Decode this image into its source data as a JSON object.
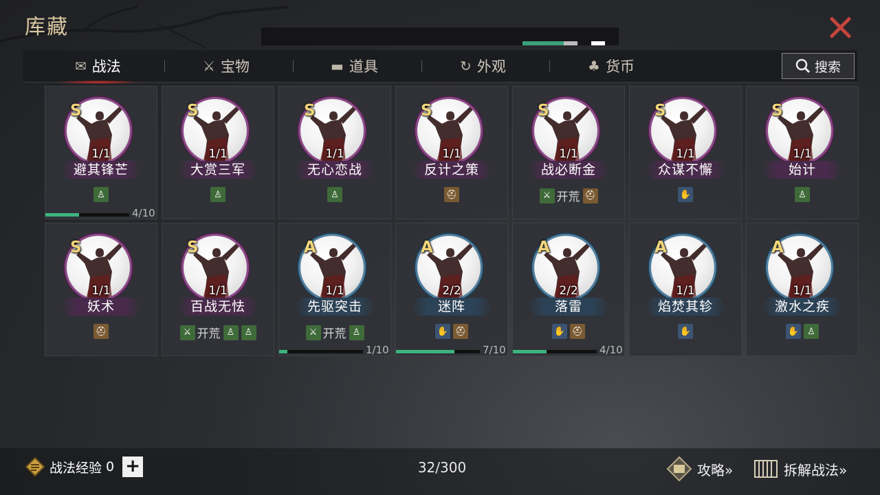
{
  "header": {
    "title": "库藏"
  },
  "tabs": [
    {
      "label": "战法",
      "icon": "scroll-bundle-icon",
      "active": true
    },
    {
      "label": "宝物",
      "icon": "treasure-weapon-icon",
      "active": false
    },
    {
      "label": "道具",
      "icon": "chest-icon",
      "active": false
    },
    {
      "label": "外观",
      "icon": "appearance-swirl-icon",
      "active": false
    },
    {
      "label": "货币",
      "icon": "money-bag-icon",
      "active": false
    }
  ],
  "search": {
    "label": "搜索"
  },
  "cards": [
    {
      "grade": "S",
      "count": "1/1",
      "name": "避其锋芒",
      "tags": [
        "green"
      ],
      "progress": {
        "value": 4,
        "max": 10,
        "text": "4/10"
      }
    },
    {
      "grade": "S",
      "count": "1/1",
      "name": "大赏三军",
      "tags": [
        "green"
      ]
    },
    {
      "grade": "S",
      "count": "1/1",
      "name": "无心恋战",
      "tags": [
        "green"
      ]
    },
    {
      "grade": "S",
      "count": "1/1",
      "name": "反计之策",
      "tags": [
        "brown"
      ]
    },
    {
      "grade": "S",
      "count": "1/1",
      "name": "战必断金",
      "kaihuang": "开荒",
      "tags": [
        "brown"
      ]
    },
    {
      "grade": "S",
      "count": "1/1",
      "name": "众谋不懈",
      "tags": [
        "blue"
      ]
    },
    {
      "grade": "S",
      "count": "1/1",
      "name": "始计",
      "tags": [
        "green"
      ]
    },
    {
      "grade": "S",
      "count": "1/1",
      "name": "妖术",
      "tags": [
        "brown"
      ]
    },
    {
      "grade": "S",
      "count": "1/1",
      "name": "百战无怯",
      "kaihuang": "开荒",
      "tags": [
        "green",
        "green"
      ]
    },
    {
      "grade": "A",
      "count": "1/1",
      "name": "先驱突击",
      "kaihuang": "开荒",
      "tags": [
        "green"
      ],
      "progress": {
        "value": 1,
        "max": 10,
        "text": "1/10"
      }
    },
    {
      "grade": "A",
      "count": "2/2",
      "name": "迷阵",
      "tags": [
        "blue",
        "brown"
      ],
      "progress": {
        "value": 7,
        "max": 10,
        "text": "7/10"
      }
    },
    {
      "grade": "A",
      "count": "2/2",
      "name": "落雷",
      "tags": [
        "blue",
        "brown"
      ],
      "progress": {
        "value": 4,
        "max": 10,
        "text": "4/10"
      }
    },
    {
      "grade": "A",
      "count": "1/1",
      "name": "焰焚其轸",
      "tags": [
        "blue"
      ]
    },
    {
      "grade": "A",
      "count": "1/1",
      "name": "激水之疾",
      "tags": [
        "blue",
        "green"
      ]
    }
  ],
  "footer": {
    "exp_label": "战法经验",
    "exp_value": "0",
    "plus": "+",
    "total": "32/300",
    "guide_label": "攻略»",
    "dismantle_label": "拆解战法»"
  },
  "colors": {
    "grade_S": "#8e4a8a",
    "grade_A": "#4e7fa0",
    "progress": "#3cb47e",
    "close": "#c4453d"
  }
}
